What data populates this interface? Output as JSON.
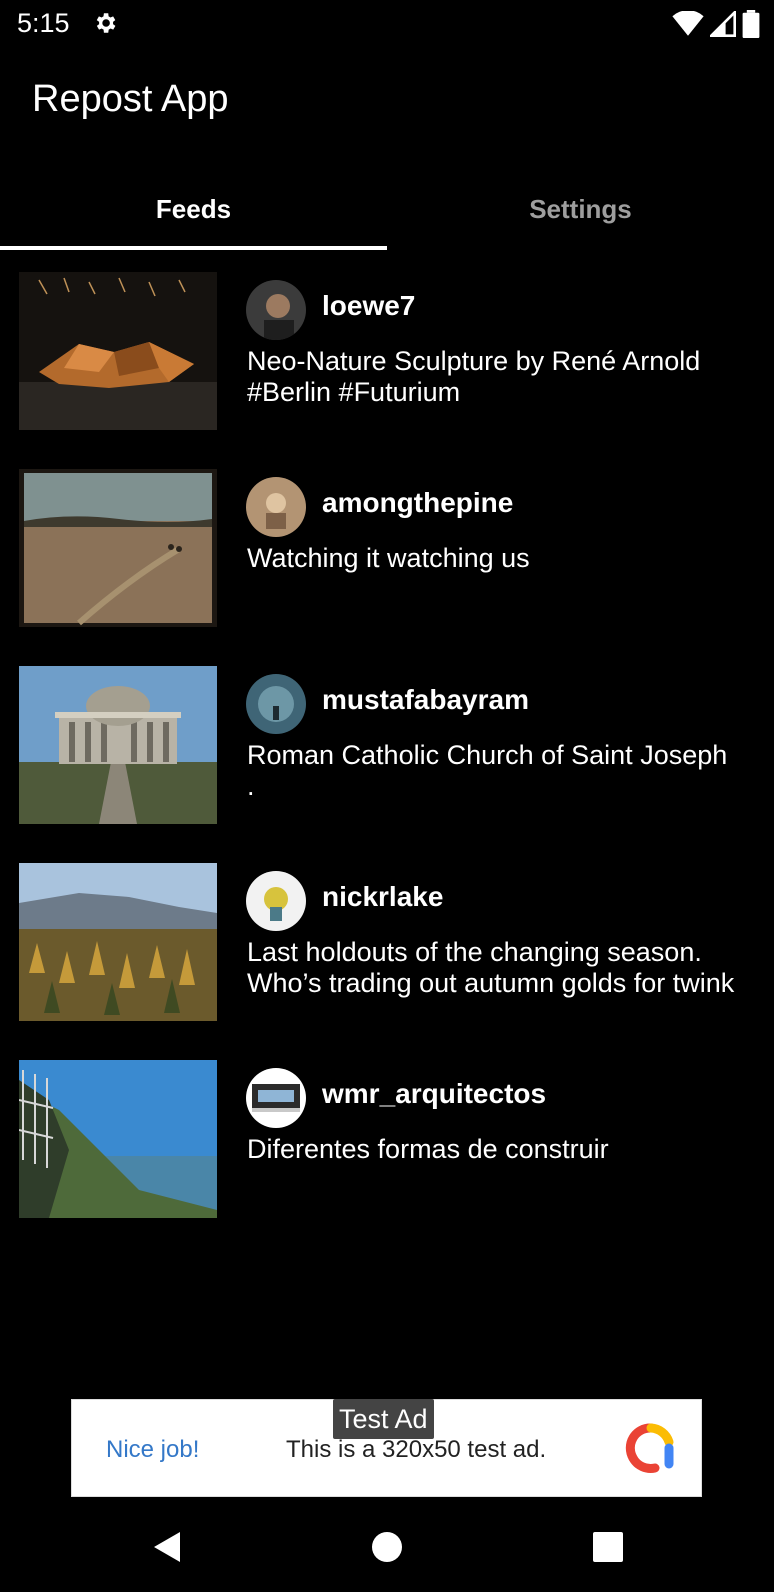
{
  "status_bar": {
    "time": "5:15",
    "icons": [
      "gear-icon",
      "wifi-icon",
      "signal-icon",
      "battery-icon"
    ]
  },
  "app_bar": {
    "title": "Repost App"
  },
  "tabs": [
    {
      "label": "Feeds",
      "selected": true
    },
    {
      "label": "Settings",
      "selected": false
    }
  ],
  "feed": [
    {
      "username": "loewe7",
      "caption": "Neo-Nature Sculpture by René Arnold\n#Berlin #Futurium"
    },
    {
      "username": "amongthepine",
      "caption": "Watching it watching us"
    },
    {
      "username": "mustafabayram",
      "caption": "Roman Catholic Church of Saint Joseph\n."
    },
    {
      "username": "nickrlake",
      "caption": "Last holdouts of the changing season.\nWho’s trading out autumn golds for twink"
    },
    {
      "username": "wmr_arquitectos",
      "caption": "Diferentes formas de construir"
    }
  ],
  "ad": {
    "badge": "Test Ad",
    "headline": "Nice job!",
    "body": "This is a 320x50 test ad.",
    "logo": "ad-logo-icon"
  },
  "nav_bar": {
    "icons": [
      "back-icon",
      "home-icon",
      "recents-icon"
    ]
  },
  "colors": {
    "background": "#000000",
    "selected_tab": "#ffffff",
    "unselected_tab": "#9e9e9e",
    "ad_headline": "#3478c8"
  }
}
